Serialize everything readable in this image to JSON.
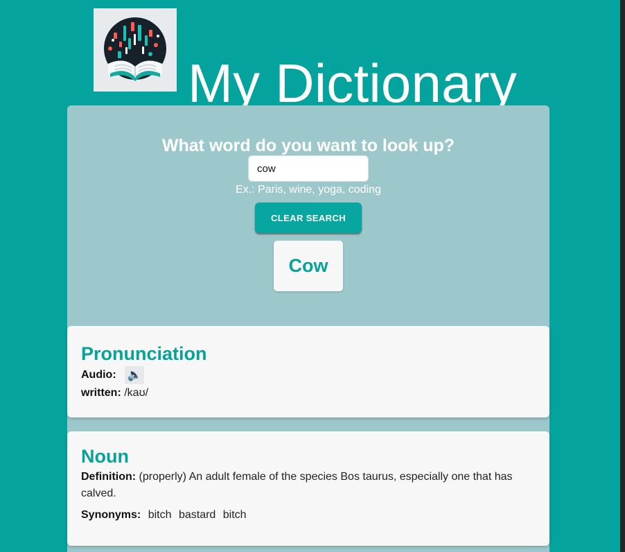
{
  "app": {
    "title": "My Dictionary",
    "logo_icon": "book-logo-icon"
  },
  "search": {
    "prompt": "What word do you want to look up?",
    "value": "cow",
    "hint": "Ex.: Paris, wine, yoga, coding",
    "clear_label": "CLEAR SEARCH",
    "result_word": "Cow"
  },
  "pronunciation": {
    "title": "Pronunciation",
    "audio_label": "Audio:",
    "audio_icon": "speaker-icon",
    "audio_glyph": "🔈",
    "written_label": "written:",
    "written_value": "/kaʊ/"
  },
  "meaning": {
    "title": "Noun",
    "definition_label": "Definition:",
    "definition": "(properly) An adult female of the species Bos taurus, especially one that has calved.",
    "synonyms_label": "Synonyms:",
    "synonyms": [
      "bitch",
      "bastard",
      "bitch"
    ]
  },
  "colors": {
    "background": "#05a39d",
    "panel": "#9dc8cb",
    "accent": "#07a39b",
    "card": "#f7f7f7"
  }
}
